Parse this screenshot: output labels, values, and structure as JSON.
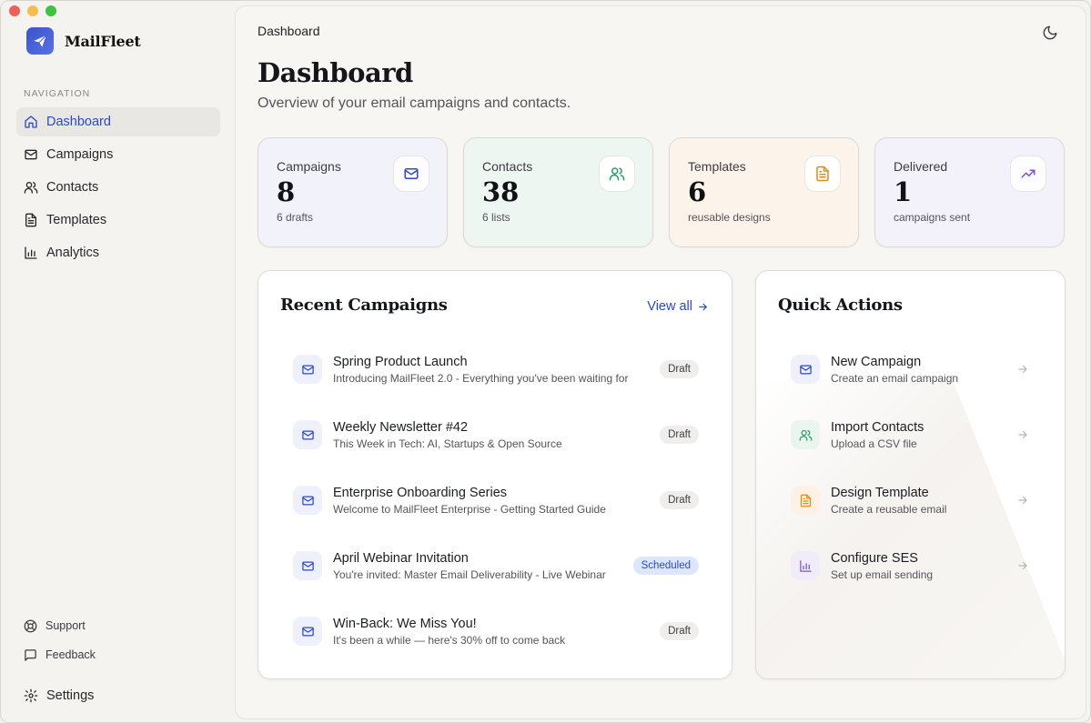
{
  "app": {
    "name": "MailFleet"
  },
  "nav": {
    "heading": "NAVIGATION",
    "items": [
      {
        "label": "Dashboard",
        "icon": "home-icon",
        "active": true
      },
      {
        "label": "Campaigns",
        "icon": "mail-icon",
        "active": false
      },
      {
        "label": "Contacts",
        "icon": "users-icon",
        "active": false
      },
      {
        "label": "Templates",
        "icon": "file-text-icon",
        "active": false
      },
      {
        "label": "Analytics",
        "icon": "bar-chart-icon",
        "active": false
      }
    ],
    "support": "Support",
    "feedback": "Feedback",
    "settings": "Settings"
  },
  "header": {
    "breadcrumb": "Dashboard",
    "title": "Dashboard",
    "subtitle": "Overview of your email campaigns and contacts."
  },
  "stats": [
    {
      "label": "Campaigns",
      "value": "8",
      "note": "6 drafts",
      "icon": "mail-icon",
      "bg": "#f1f2fa",
      "accent": "#2c47c7"
    },
    {
      "label": "Contacts",
      "value": "38",
      "note": "6 lists",
      "icon": "users-icon",
      "bg": "#eef6f2",
      "accent": "#2e9a63"
    },
    {
      "label": "Templates",
      "value": "6",
      "note": "reusable designs",
      "icon": "file-text-icon",
      "bg": "#fcf3ea",
      "accent": "#e08a1e"
    },
    {
      "label": "Delivered",
      "value": "1",
      "note": "campaigns sent",
      "icon": "trending-up-icon",
      "bg": "#f3f1f9",
      "accent": "#7d4fd6"
    }
  ],
  "recent": {
    "title": "Recent Campaigns",
    "view_all": "View all",
    "items": [
      {
        "title": "Spring Product Launch",
        "desc": "Introducing MailFleet 2.0 - Everything you've been waiting for",
        "status": "Draft"
      },
      {
        "title": "Weekly Newsletter #42",
        "desc": "This Week in Tech: AI, Startups & Open Source",
        "status": "Draft"
      },
      {
        "title": "Enterprise Onboarding Series",
        "desc": "Welcome to MailFleet Enterprise - Getting Started Guide",
        "status": "Draft"
      },
      {
        "title": "April Webinar Invitation",
        "desc": "You're invited: Master Email Deliverability - Live Webinar",
        "status": "Scheduled"
      },
      {
        "title": "Win-Back: We Miss You!",
        "desc": "It's been a while — here's 30% off to come back",
        "status": "Draft"
      }
    ]
  },
  "quick": {
    "title": "Quick Actions",
    "items": [
      {
        "title": "New Campaign",
        "desc": "Create an email campaign",
        "icon": "mail-icon",
        "bg": "#eef0fb",
        "accent": "#2c47c7"
      },
      {
        "title": "Import Contacts",
        "desc": "Upload a CSV file",
        "icon": "users-icon",
        "bg": "#eaf5ef",
        "accent": "#2e9a63"
      },
      {
        "title": "Design Template",
        "desc": "Create a reusable email",
        "icon": "file-text-icon",
        "bg": "#fcf1e4",
        "accent": "#e08a1e"
      },
      {
        "title": "Configure SES",
        "desc": "Set up email sending",
        "icon": "bar-chart-icon",
        "bg": "#f1ecfa",
        "accent": "#7d4fd6"
      }
    ]
  }
}
